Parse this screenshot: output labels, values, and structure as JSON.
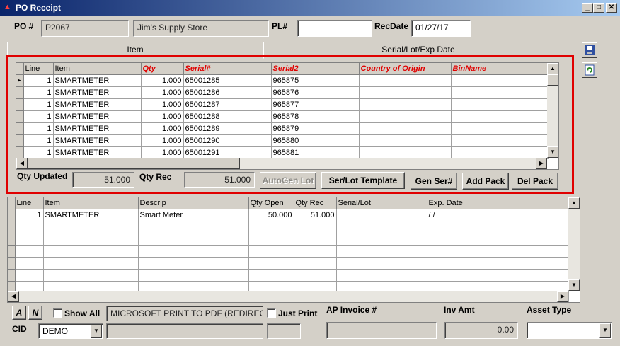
{
  "window": {
    "title": "PO Receipt",
    "controls": {
      "min": "_",
      "max": "□",
      "close": "✕"
    }
  },
  "header": {
    "po_label": "PO #",
    "po_value": "P2067",
    "vendor": "Jim's Supply Store",
    "pl_label": "PL#",
    "pl_value": "",
    "recdate_label": "RecDate",
    "recdate_value": "01/27/17"
  },
  "tabs": [
    "Item",
    "Serial/Lot/Exp Date"
  ],
  "serial_grid": {
    "columns": [
      "Line",
      "Item",
      "Qty",
      "Serial#",
      "Serial2",
      "Country of Origin",
      "BinName"
    ],
    "rows": [
      [
        "1",
        "SMARTMETER",
        "1.000",
        "65001285",
        "965875",
        "",
        ""
      ],
      [
        "1",
        "SMARTMETER",
        "1.000",
        "65001286",
        "965876",
        "",
        ""
      ],
      [
        "1",
        "SMARTMETER",
        "1.000",
        "65001287",
        "965877",
        "",
        ""
      ],
      [
        "1",
        "SMARTMETER",
        "1.000",
        "65001288",
        "965878",
        "",
        ""
      ],
      [
        "1",
        "SMARTMETER",
        "1.000",
        "65001289",
        "965879",
        "",
        ""
      ],
      [
        "1",
        "SMARTMETER",
        "1.000",
        "65001290",
        "965880",
        "",
        ""
      ],
      [
        "1",
        "SMARTMETER",
        "1.000",
        "65001291",
        "965881",
        "",
        ""
      ]
    ]
  },
  "serial_panel": {
    "qty_updated_label": "Qty Updated",
    "qty_updated_value": "51.000",
    "qty_rec_label": "Qty Rec",
    "qty_rec_value": "51.000",
    "autogen_label": "AutoGen Lot",
    "template_label": "Ser/Lot Template",
    "genser_label": "Gen Ser#",
    "addpack_label": "Add Pack",
    "delpack_label": "Del Pack"
  },
  "item_grid": {
    "columns": [
      "Line",
      "Item",
      "Descrip",
      "Qty Open",
      "Qty Rec",
      "Serial/Lot",
      "Exp. Date"
    ],
    "rows": [
      [
        "1",
        "SMARTMETER",
        "Smart Meter",
        "50.000",
        "51.000",
        "",
        "/  /"
      ]
    ],
    "empty_rows": 7
  },
  "footer": {
    "a_btn": "A",
    "n_btn": "N",
    "show_all_label": "Show All",
    "printer_value": "MICROSOFT PRINT TO PDF (REDIREC",
    "just_print_label": "Just Print",
    "ap_invoice_label": "AP Invoice #",
    "inv_amt_label": "Inv Amt",
    "inv_amt_value": "0.00",
    "asset_type_label": "Asset Type",
    "asset_type_value": "",
    "cid_label": "CID",
    "cid_value": "DEMO"
  },
  "icons": [
    "save-icon",
    "refresh-icon"
  ],
  "colors": {
    "title_bar": "#0a246a",
    "highlight_border": "#e00000",
    "required_header": "#e00000",
    "face": "#d4d0c8"
  }
}
